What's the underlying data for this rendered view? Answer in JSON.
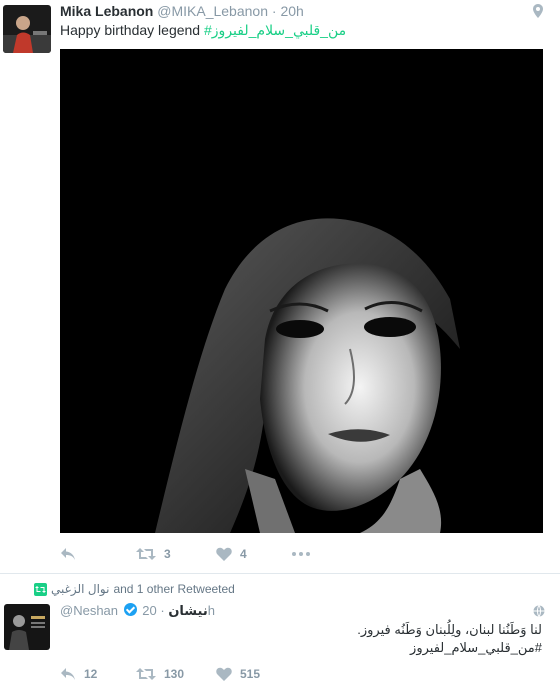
{
  "tweet1": {
    "author": {
      "name": "Mika Lebanon",
      "handle": "@MIKA_Lebanon",
      "time": "20h"
    },
    "text": "Happy birthday legend",
    "hashtag": "#من_قلبي_سلام_لفيروز",
    "actions": {
      "retweets": "3",
      "likes": "4"
    }
  },
  "retweet_context": {
    "retweeter": "نوال الزغبي",
    "text": "and 1 other Retweeted"
  },
  "tweet2": {
    "author": {
      "name": "نيشان",
      "handle": "@Neshan",
      "time": "20h"
    },
    "text_line1": "لنا وَطَنُنا لبنان، ولِلُبنان وَطَنُه فيروز.",
    "hashtag": "#من_قلبي_سلام_لفيروز",
    "actions": {
      "replies": "12",
      "retweets": "130",
      "likes": "515"
    }
  },
  "colors": {
    "hashtag": "#19cf86",
    "verified": "#1da1f2",
    "meta": "#8899a6",
    "icon": "#aab8c2"
  },
  "icons": [
    "geo-pin-icon",
    "reply-icon",
    "retweet-icon",
    "heart-icon",
    "more-icon",
    "retweet-badge-icon",
    "globe-icon",
    "verified-icon"
  ]
}
